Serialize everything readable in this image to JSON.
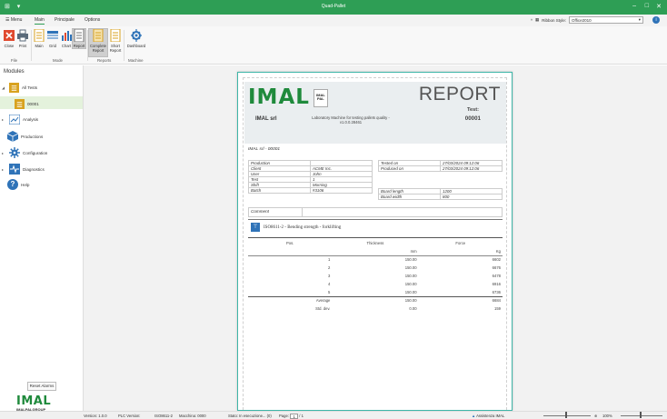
{
  "window": {
    "title": "Quad-Pallet",
    "controls": [
      "–",
      "□",
      "✕"
    ]
  },
  "menubar": {
    "items": [
      "Menu",
      "Main",
      "Principale",
      "Options"
    ],
    "active": "Main",
    "ribbon_style_label": "Ribbon Style:",
    "ribbon_style_value": "Office2010"
  },
  "ribbon": {
    "buttons": {
      "close": "Close",
      "print": "Print",
      "main": "Main",
      "grid": "Grid",
      "chart": "Chart",
      "report": "Report",
      "complete_report": "Complete Report",
      "short_report": "Short Report",
      "dashboard": "Dashboard"
    },
    "groups": {
      "file": "File",
      "mode": "Mode",
      "reports": "Reports",
      "machine": "Machine"
    },
    "colors": {
      "close_icon": "#e04a2f",
      "print_icon": "#5a6a7a",
      "doc_icon": "#d8a21f",
      "grid_icon": "#2f73b8",
      "chart_icon": "#2f73b8",
      "gear_icon": "#2f73b8"
    }
  },
  "nav": {
    "header": "Modules",
    "items": {
      "all_tests": "All Tests",
      "test_00001": "00001",
      "analysis": "Analysis",
      "productions": "Productions",
      "configuration": "Configuration",
      "diagnostics": "Diagnostics",
      "help": "Help"
    },
    "reset_alarms": "Reset Alarms",
    "logo_text": "IMAL",
    "logo_sub": "IMALPALGROUP"
  },
  "report": {
    "title": "REPORT",
    "test_label": "Test:",
    "test_value": "00001",
    "company": "IMAL srl",
    "description": "Laboratory Machine for testing pallets quality - v1.0.0.28461",
    "subtitle_id": "IMAL srl - 00001",
    "info_left": [
      [
        "Production",
        ""
      ],
      [
        "Client",
        "ACME Inc."
      ],
      [
        "User",
        "John"
      ],
      [
        "Test",
        "1"
      ],
      [
        "Shift",
        "Morning"
      ],
      [
        "Batch",
        "#3106"
      ]
    ],
    "info_right_top": [
      [
        "Tested on",
        "27/03/2024 09:12:06"
      ],
      [
        "Produced on",
        "27/03/2024 09:12:06"
      ]
    ],
    "info_right_bottom": [
      [
        "Board length",
        "1200"
      ],
      [
        "Board width",
        "800"
      ]
    ],
    "comment_label": "Comment",
    "section_title": "ISO8611-2 - Bending strength - forklifting",
    "table": {
      "headers": [
        "Pos.",
        "Thickness",
        "Force"
      ],
      "units": [
        "",
        "mm",
        "Kg"
      ],
      "rows": [
        [
          "1",
          "150.00",
          "6602"
        ],
        [
          "2",
          "150.00",
          "6676"
        ],
        [
          "3",
          "150.00",
          "6478"
        ],
        [
          "4",
          "150.00",
          "6916"
        ],
        [
          "5",
          "150.00",
          "6736"
        ]
      ],
      "average": [
        "Average",
        "150.00",
        "6684"
      ],
      "stddev": [
        "Std. dev.",
        "0.00",
        "159"
      ]
    }
  },
  "status": {
    "version": "Version: 1.0.0",
    "plc": "PLC Version:",
    "standard": "ISO8611-2",
    "machine": "Macchina: 0000",
    "state": "Stato: In esecuzione... (0)",
    "page_label": "Page:",
    "page_value": "1",
    "page_total": "/ 1",
    "assist": "Assistenza IMAL",
    "zoom": "100%"
  }
}
